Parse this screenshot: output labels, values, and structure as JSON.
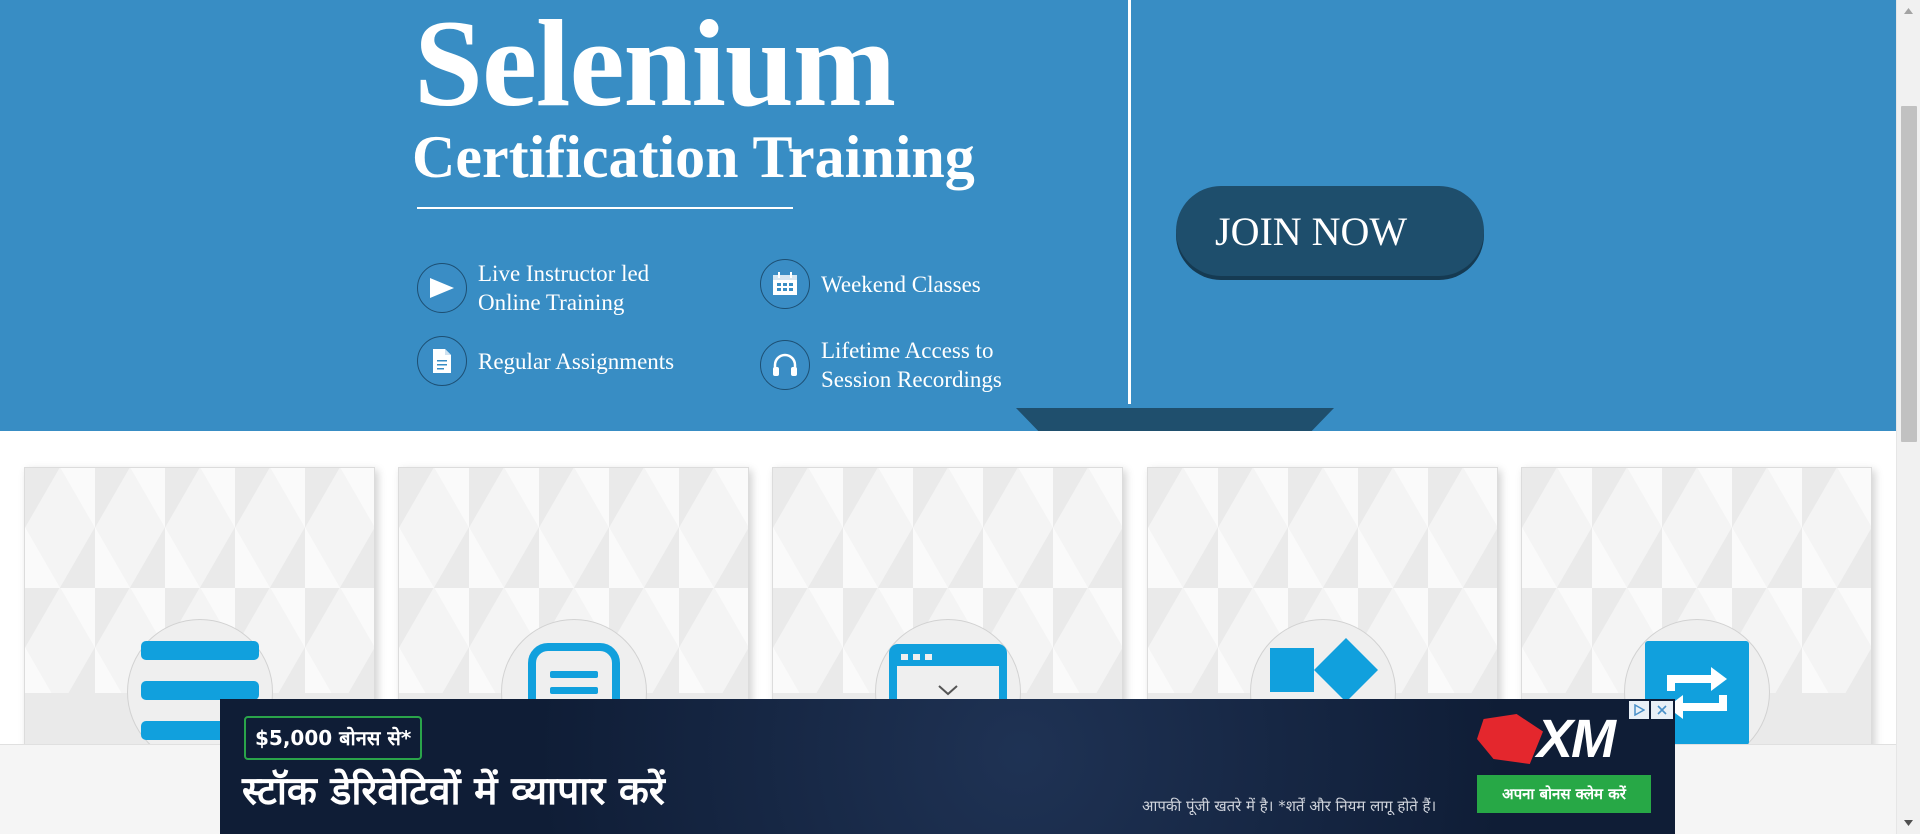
{
  "hero": {
    "title": "Selenium",
    "subtitle": "Certification Training",
    "features": [
      {
        "label": "Live Instructor led Online Training",
        "icon": "play-icon"
      },
      {
        "label": "Weekend Classes",
        "icon": "calendar-icon"
      },
      {
        "label": "Regular Assignments",
        "icon": "document-icon"
      },
      {
        "label": "Lifetime Access to Session Recordings",
        "icon": "headphones-icon"
      }
    ],
    "join_label": "JOIN NOW",
    "colors": {
      "background": "#388dc4",
      "button": "#1e4e6c"
    }
  },
  "cards": [
    {
      "icon": "menu-icon"
    },
    {
      "icon": "document-list-icon"
    },
    {
      "icon": "browser-window-icon"
    },
    {
      "icon": "shapes-icon"
    },
    {
      "icon": "repeat-icon"
    }
  ],
  "ad": {
    "badge": "$5,000 बोनस से*",
    "headline": "स्टॉक डेरिवेटिवों में व्यापार करें",
    "brand": "XM",
    "disclaimer": "आपकी पूंजी खतरे में है। *शर्तें और नियम लागू होते हैं।",
    "cta": "अपना बोनस क्लेम करें",
    "colors": {
      "background": "#0f1d36",
      "cta": "#27a846",
      "logo": "#e4272d"
    }
  }
}
